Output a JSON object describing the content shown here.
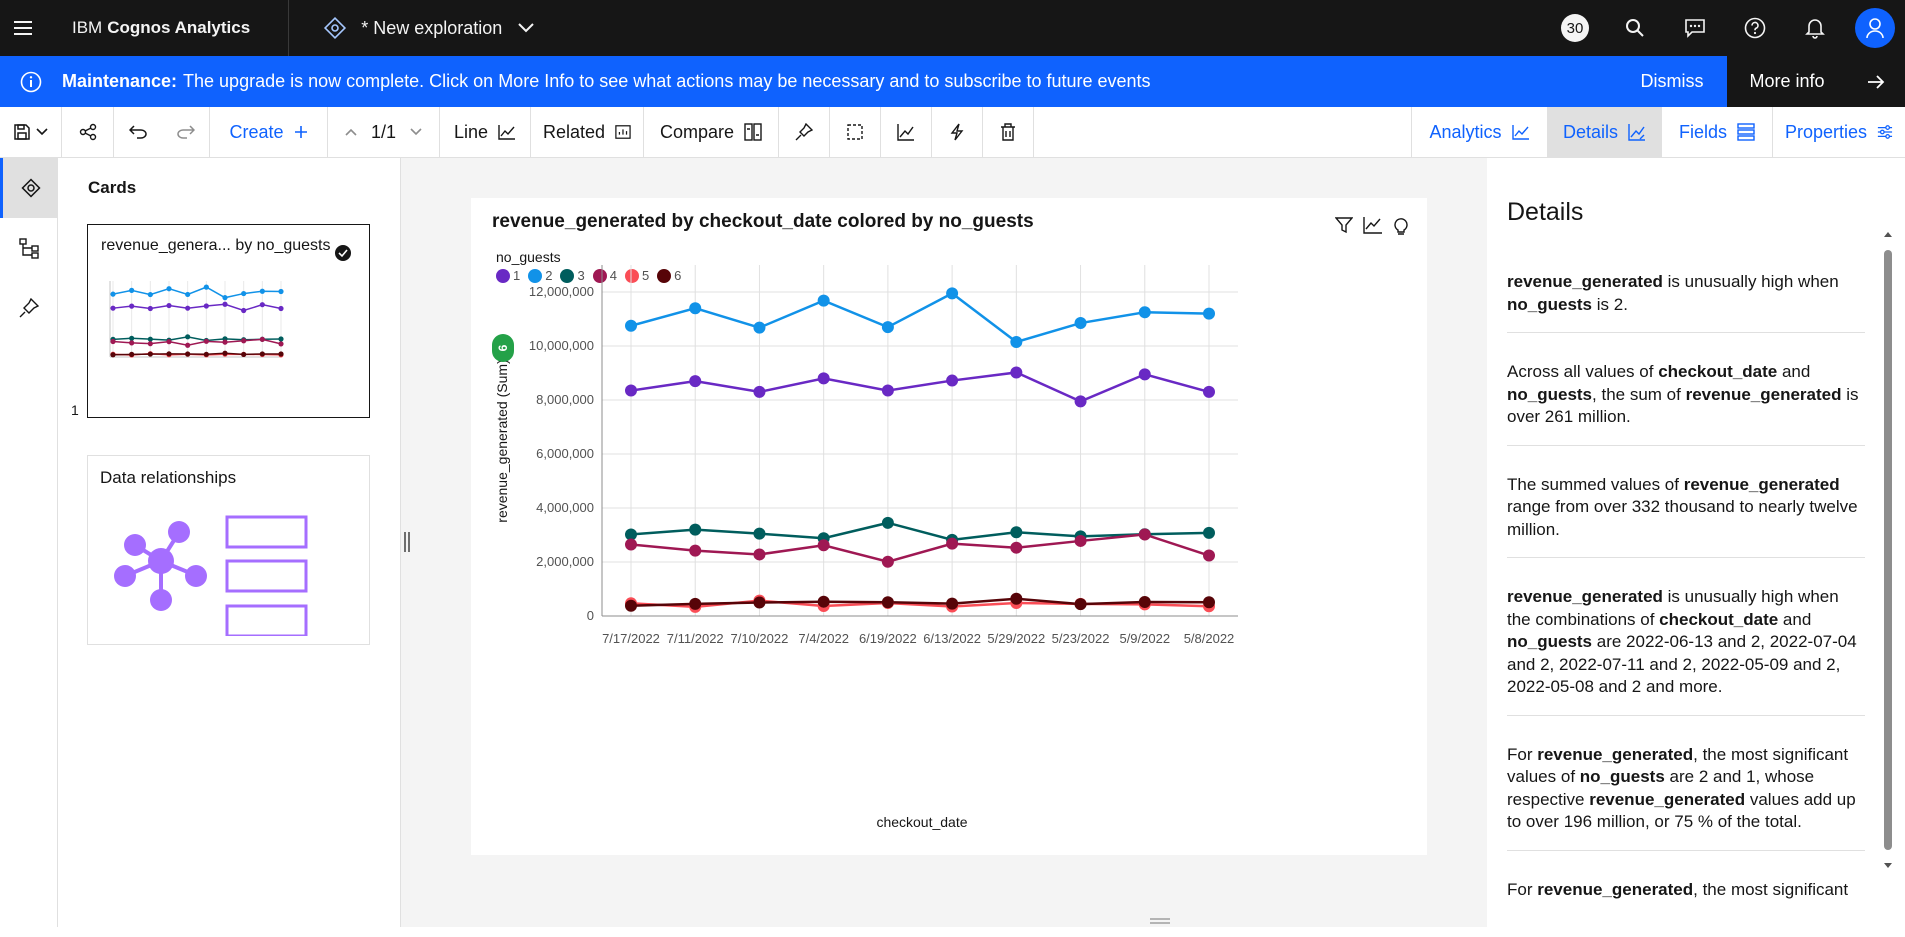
{
  "topbar": {
    "brand_prefix": "IBM",
    "brand_name": "Cognos Analytics",
    "exploration_title": "* New exploration",
    "notifications_count": "30"
  },
  "banner": {
    "title": "Maintenance:",
    "message": "The upgrade is now complete. Click on More Info to see what actions may be necessary and to subscribe to future events",
    "dismiss_label": "Dismiss",
    "more_label": "More info"
  },
  "toolbar": {
    "create_label": "Create",
    "page_indicator": "1/1",
    "line_label": "Line",
    "related_label": "Related",
    "compare_label": "Compare",
    "analytics_label": "Analytics",
    "details_label": "Details",
    "fields_label": "Fields",
    "properties_label": "Properties"
  },
  "cards_panel": {
    "title": "Cards",
    "card1_title": "revenue_genera... by no_guests",
    "card1_number": "1",
    "card2_title": "Data relationships"
  },
  "chart_panel": {
    "title": "revenue_generated by checkout_date colored by no_guests",
    "count_badge": "6"
  },
  "chart_data": {
    "type": "line",
    "title": "revenue_generated by checkout_date colored by no_guests",
    "xlabel": "checkout_date",
    "ylabel": "revenue_generated (Sum)",
    "legend_title": "no_guests",
    "legend_position": "top-left",
    "grid": true,
    "ylim": [
      0,
      13000000
    ],
    "yticks": [
      "0",
      "2,000,000",
      "4,000,000",
      "6,000,000",
      "8,000,000",
      "10,000,000",
      "12,000,000"
    ],
    "categories": [
      "7/17/2022",
      "7/11/2022",
      "7/10/2022",
      "7/4/2022",
      "6/19/2022",
      "6/13/2022",
      "5/29/2022",
      "5/23/2022",
      "5/9/2022",
      "5/8/2022"
    ],
    "series": [
      {
        "name": "1",
        "color": "#6929c4",
        "values": [
          8350000,
          8700000,
          8300000,
          8800000,
          8350000,
          8720000,
          9020000,
          7950000,
          8950000,
          8300000
        ]
      },
      {
        "name": "2",
        "color": "#1192e8",
        "values": [
          10750000,
          11400000,
          10680000,
          11680000,
          10700000,
          11950000,
          10150000,
          10850000,
          11250000,
          11200000
        ]
      },
      {
        "name": "3",
        "color": "#005d5d",
        "values": [
          3020000,
          3200000,
          3050000,
          2880000,
          3450000,
          2820000,
          3100000,
          2950000,
          3030000,
          3080000
        ]
      },
      {
        "name": "4",
        "color": "#9f1853",
        "values": [
          2650000,
          2420000,
          2280000,
          2620000,
          2010000,
          2680000,
          2530000,
          2780000,
          3020000,
          2240000
        ]
      },
      {
        "name": "5",
        "color": "#fa4d56",
        "values": [
          470000,
          340000,
          570000,
          370000,
          480000,
          350000,
          480000,
          450000,
          430000,
          360000
        ]
      },
      {
        "name": "6",
        "color": "#570408",
        "values": [
          380000,
          450000,
          500000,
          530000,
          510000,
          460000,
          640000,
          440000,
          520000,
          510000
        ]
      }
    ]
  },
  "details": {
    "title": "Details",
    "items": [
      {
        "parts": [
          {
            "b": "revenue_generated"
          },
          {
            "t": " is unusually high when "
          },
          {
            "b": "no_guests"
          },
          {
            "t": " is 2."
          }
        ]
      },
      {
        "parts": [
          {
            "t": "Across all values of "
          },
          {
            "b": "checkout_date"
          },
          {
            "t": " and "
          },
          {
            "b": "no_guests"
          },
          {
            "t": ", the sum of "
          },
          {
            "b": "revenue_generated"
          },
          {
            "t": " is over 261 million."
          }
        ]
      },
      {
        "parts": [
          {
            "t": "The summed values of "
          },
          {
            "b": "revenue_generated"
          },
          {
            "t": " range from over 332 thousand to nearly twelve million."
          }
        ]
      },
      {
        "parts": [
          {
            "b": "revenue_generated"
          },
          {
            "t": " is unusually high when the combinations of "
          },
          {
            "b": "checkout_date"
          },
          {
            "t": " and "
          },
          {
            "b": "no_guests"
          },
          {
            "t": " are 2022-06-13 and 2, 2022-07-04 and 2, 2022-07-11 and 2, 2022-05-09 and 2, 2022-05-08 and 2 and more."
          }
        ]
      },
      {
        "parts": [
          {
            "t": "For "
          },
          {
            "b": "revenue_generated"
          },
          {
            "t": ", the most significant values of "
          },
          {
            "b": "no_guests"
          },
          {
            "t": " are 2 and 1, whose respective "
          },
          {
            "b": "revenue_generated"
          },
          {
            "t": " values add up to over 196 million, or 75 % of the total."
          }
        ]
      },
      {
        "parts": [
          {
            "t": "For "
          },
          {
            "b": "revenue_generated"
          },
          {
            "t": ", the most significant"
          }
        ]
      }
    ]
  }
}
